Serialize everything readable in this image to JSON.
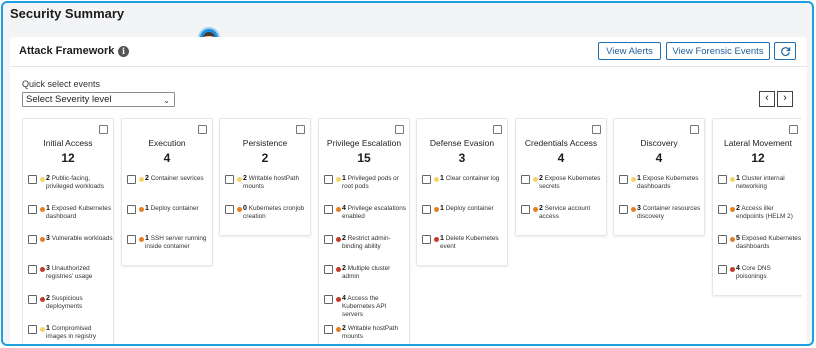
{
  "page": {
    "title": "Security Summary"
  },
  "panel": {
    "title": "Attack Framework",
    "view_alerts_label": "View Alerts",
    "view_forensic_label": "View Forensic Events",
    "refresh_icon": "refresh-icon",
    "info_icon": "info-icon"
  },
  "quick_select": {
    "label": "Quick select events",
    "severity_value": "Select Severity level"
  },
  "colors": {
    "high": "#c0392b",
    "medium": "#e67e22",
    "low": "#f5d36a",
    "accent": "#1f6fb5"
  },
  "columns": [
    {
      "title": "Initial Access",
      "count": "12",
      "events": [
        {
          "num": "2",
          "text": "Public-facing, privileged workloads",
          "sev": "low"
        },
        {
          "num": "1",
          "text": "Exposed Kubernetes dashboard",
          "sev": "medium"
        },
        {
          "num": "3",
          "text": "Vulnerable workloads",
          "sev": "medium"
        },
        {
          "num": "3",
          "text": "Unauthorized registries' usage",
          "sev": "high"
        },
        {
          "num": "2",
          "text": "Suspicious deployments",
          "sev": "high"
        },
        {
          "num": "1",
          "text": "Compromised images in registry",
          "sev": "low"
        }
      ]
    },
    {
      "title": "Execution",
      "count": "4",
      "events": [
        {
          "num": "2",
          "text": "Container sevrices",
          "sev": "low"
        },
        {
          "num": "1",
          "text": "Deploy container",
          "sev": "medium"
        },
        {
          "num": "1",
          "text": "SSH server running inside container",
          "sev": "medium"
        }
      ]
    },
    {
      "title": "Persistence",
      "count": "2",
      "events": [
        {
          "num": "2",
          "text": "Writable hostPath mounts",
          "sev": "low"
        },
        {
          "num": "0",
          "text": "Kubernetes cronjob creation",
          "sev": "medium"
        }
      ]
    },
    {
      "title": "Privilege Escalation",
      "count": "15",
      "events": [
        {
          "num": "1",
          "text": "Privileged pods or root pods",
          "sev": "low"
        },
        {
          "num": "4",
          "text": "Privilege escalations enabled",
          "sev": "medium"
        },
        {
          "num": "2",
          "text": "Restrict admin-binding ability",
          "sev": "high"
        },
        {
          "num": "2",
          "text": "Multiple cluster admin",
          "sev": "high"
        },
        {
          "num": "4",
          "text": "Access the Kubernetes API servers",
          "sev": "high"
        },
        {
          "num": "2",
          "text": "Writable hostPath mounts",
          "sev": "medium"
        }
      ]
    },
    {
      "title": "Defense Evasion",
      "count": "3",
      "events": [
        {
          "num": "1",
          "text": "Clear container log",
          "sev": "low"
        },
        {
          "num": "1",
          "text": "Deploy container",
          "sev": "medium"
        },
        {
          "num": "1",
          "text": "Delete Kubernetes event",
          "sev": "high"
        }
      ]
    },
    {
      "title": "Credentials Access",
      "count": "4",
      "events": [
        {
          "num": "2",
          "text": "Expose Kubernetes secrets",
          "sev": "low"
        },
        {
          "num": "2",
          "text": "Service account access",
          "sev": "medium"
        }
      ]
    },
    {
      "title": "Discovery",
      "count": "4",
      "events": [
        {
          "num": "1",
          "text": "Expose Kubernetes dashboards",
          "sev": "low"
        },
        {
          "num": "3",
          "text": "Container resources discovery",
          "sev": "medium"
        }
      ]
    },
    {
      "title": "Lateral Movement",
      "count": "12",
      "events": [
        {
          "num": "1",
          "text": "Cluster internal networking",
          "sev": "low"
        },
        {
          "num": "2",
          "text": "Access iller endpoints (HELM 2)",
          "sev": "medium"
        },
        {
          "num": "5",
          "text": "Exposed Kubernetes dashboards",
          "sev": "medium"
        },
        {
          "num": "4",
          "text": "Core DNS poisonings",
          "sev": "high"
        }
      ]
    }
  ]
}
